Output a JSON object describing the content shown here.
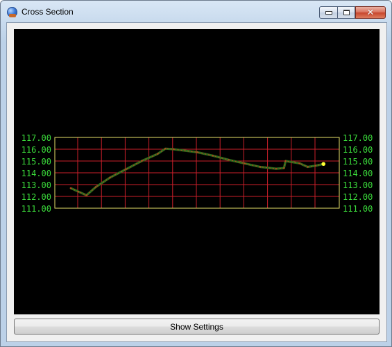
{
  "window": {
    "title": "Cross Section",
    "controls": {
      "minimize": "minimize",
      "maximize": "maximize",
      "close": "close"
    }
  },
  "buttons": {
    "show_settings": "Show Settings"
  },
  "colors": {
    "plot_background": "#000000",
    "grid_lines": "#cc1f2a",
    "frame": "#e8e26a",
    "tick_labels": "#3bdc3b",
    "profile_dark": "#2e6b1c",
    "profile_light": "#b0461c",
    "end_marker": "#ffff33"
  },
  "chart_data": {
    "type": "line",
    "title": "",
    "xlabel": "",
    "ylabel": "",
    "ylim": [
      111.0,
      117.0
    ],
    "yticks": [
      "117.00",
      "116.00",
      "115.00",
      "114.00",
      "113.00",
      "112.00",
      "111.00"
    ],
    "grid": true,
    "y_labels_both_sides": true,
    "series": [
      {
        "points": [
          [
            0.0,
            112.7
          ],
          [
            0.5,
            112.4
          ],
          [
            1.0,
            112.1
          ],
          [
            1.6,
            112.8
          ],
          [
            2.5,
            113.6
          ],
          [
            3.5,
            114.3
          ],
          [
            4.5,
            115.0
          ],
          [
            5.5,
            115.6
          ],
          [
            6.0,
            116.05
          ],
          [
            6.5,
            116.0
          ],
          [
            8.0,
            115.75
          ],
          [
            9.0,
            115.45
          ],
          [
            10.0,
            115.1
          ],
          [
            11.0,
            114.8
          ],
          [
            12.0,
            114.5
          ],
          [
            13.0,
            114.35
          ],
          [
            13.5,
            114.4
          ],
          [
            13.6,
            115.0
          ],
          [
            14.5,
            114.8
          ],
          [
            15.0,
            114.5
          ],
          [
            15.5,
            114.6
          ],
          [
            16.0,
            114.75
          ]
        ],
        "end_point": [
          16.0,
          114.75
        ]
      }
    ],
    "xlim": [
      -1.0,
      17.0
    ]
  }
}
